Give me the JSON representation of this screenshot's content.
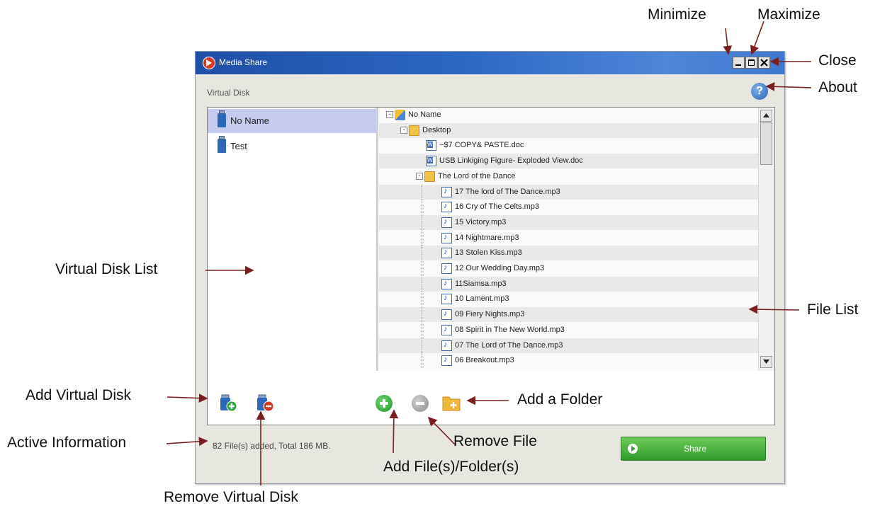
{
  "window": {
    "title": "Media Share",
    "colors": {
      "titlebar": "#2c67c3",
      "selection": "#c6cbf0",
      "share": "#3a9d34"
    }
  },
  "virtual_disk_label": "Virtual Disk",
  "disks": [
    {
      "name": "No Name",
      "selected": true
    },
    {
      "name": "Test",
      "selected": false
    }
  ],
  "tree": [
    {
      "label": "No Name",
      "type": "root",
      "toggle": "-"
    },
    {
      "label": "Desktop",
      "type": "folder",
      "toggle": "-"
    },
    {
      "label": "~$7 COPY& PASTE.doc",
      "type": "doc"
    },
    {
      "label": "USB Linkiging Figure- Exploded View.doc",
      "type": "doc"
    },
    {
      "label": "The Lord of the Dance",
      "type": "folder",
      "toggle": "-"
    },
    {
      "label": "17 The lord of The Dance.mp3",
      "type": "mp3"
    },
    {
      "label": "16 Cry of The Celts.mp3",
      "type": "mp3"
    },
    {
      "label": "15 Victory.mp3",
      "type": "mp3"
    },
    {
      "label": "14 Nightmare.mp3",
      "type": "mp3"
    },
    {
      "label": "13 Stolen Kiss.mp3",
      "type": "mp3"
    },
    {
      "label": "12 Our Wedding Day.mp3",
      "type": "mp3"
    },
    {
      "label": "11Siamsa.mp3",
      "type": "mp3"
    },
    {
      "label": "10 Lament.mp3",
      "type": "mp3"
    },
    {
      "label": "09 Fiery Nights.mp3",
      "type": "mp3"
    },
    {
      "label": "08 Spirit in The New World.mp3",
      "type": "mp3"
    },
    {
      "label": "07 The Lord of The Dance.mp3",
      "type": "mp3"
    },
    {
      "label": "06 Breakout.mp3",
      "type": "mp3"
    }
  ],
  "status": "82 File(s) added, Total 186 MB.",
  "share_label": "Share",
  "icons": [
    "app-icon",
    "minimize-icon",
    "maximize-icon",
    "close-icon",
    "help-icon",
    "usb-disk-icon",
    "add-disk-icon",
    "remove-disk-icon",
    "add-icon",
    "remove-icon",
    "add-folder-icon",
    "play-icon"
  ],
  "annotations": {
    "minimize": "Minimize",
    "maximize": "Maximize",
    "close": "Close",
    "about": "About",
    "virtual_disk_list": "Virtual Disk List",
    "file_list": "File List",
    "add_virtual_disk": "Add Virtual Disk",
    "add_a_folder": "Add a Folder",
    "active_information": "Active Information",
    "remove_file": "Remove File",
    "add_files_folders": "Add File(s)/Folder(s)",
    "remove_virtual_disk": "Remove Virtual Disk"
  }
}
